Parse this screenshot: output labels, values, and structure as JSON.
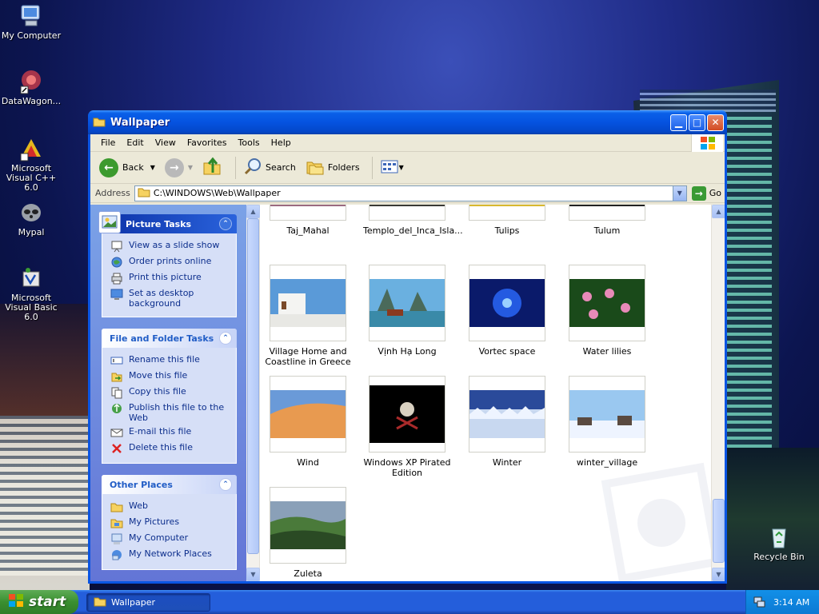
{
  "desktop": {
    "icons": [
      {
        "label": "My Computer"
      },
      {
        "label": "DataWagon..."
      },
      {
        "label": "Microsoft Visual C++ 6.0"
      },
      {
        "label": "Mypal"
      },
      {
        "label": "Microsoft Visual Basic 6.0"
      },
      {
        "label": "Recycle Bin"
      }
    ]
  },
  "window": {
    "title": "Wallpaper",
    "menu": [
      "File",
      "Edit",
      "View",
      "Favorites",
      "Tools",
      "Help"
    ],
    "toolbar": {
      "back": "Back",
      "search": "Search",
      "folders": "Folders"
    },
    "address": {
      "label": "Address",
      "value": "C:\\WINDOWS\\Web\\Wallpaper",
      "go": "Go"
    }
  },
  "panels": {
    "picture_tasks": {
      "title": "Picture Tasks",
      "items": [
        "View as a slide show",
        "Order prints online",
        "Print this picture",
        "Set as desktop background"
      ]
    },
    "file_tasks": {
      "title": "File and Folder Tasks",
      "items": [
        "Rename this file",
        "Move this file",
        "Copy this file",
        "Publish this file to the Web",
        "E-mail this file",
        "Delete this file"
      ]
    },
    "other_places": {
      "title": "Other Places",
      "items": [
        "Web",
        "My Pictures",
        "My Computer",
        "My Network Places"
      ]
    }
  },
  "files": [
    {
      "name": "Taj_Mahal"
    },
    {
      "name": "Templo_del_Inca_Isla..."
    },
    {
      "name": "Tulips"
    },
    {
      "name": "Tulum"
    },
    {
      "name": "Village Home and Coastline in Greece"
    },
    {
      "name": "Vịnh Hạ Long"
    },
    {
      "name": "Vortec space"
    },
    {
      "name": "Water lilies"
    },
    {
      "name": "Wind"
    },
    {
      "name": "Windows XP Pirated Edition"
    },
    {
      "name": "Winter"
    },
    {
      "name": "winter_village"
    },
    {
      "name": "Zuleta"
    }
  ],
  "taskbar": {
    "start": "start",
    "active_task": "Wallpaper",
    "clock": "3:14 AM"
  }
}
